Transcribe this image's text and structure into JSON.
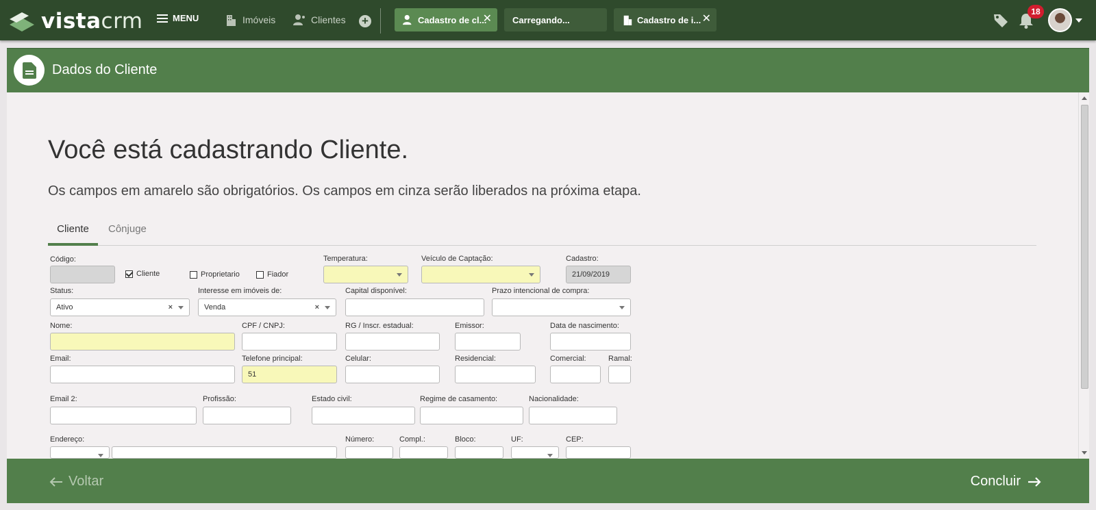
{
  "topbar": {
    "logo_bold": "vista",
    "logo_light": "crm",
    "menu_label": "MENU",
    "nav": [
      {
        "label": "Imóveis",
        "icon": "building-icon"
      },
      {
        "label": "Clientes",
        "icon": "client-icon"
      }
    ],
    "tabs": [
      {
        "label": "Cadastro de cl...",
        "icon": "client-icon",
        "active": true
      },
      {
        "label": "Carregando...",
        "icon": "",
        "active": false
      },
      {
        "label": "Cadastro de i...",
        "icon": "building-icon",
        "active": false
      }
    ],
    "notifications_count": "18",
    "colors": {
      "bar": "#2f4a2c",
      "accent": "#527f4b",
      "badge": "#d11d2e"
    }
  },
  "header": {
    "title": "Dados do Cliente",
    "icon": "document-icon"
  },
  "page": {
    "title": "Você está cadastrando Cliente.",
    "subtitle": "Os campos em amarelo são obrigatórios. Os campos em cinza serão liberados na próxima etapa.",
    "tabs": [
      "Cliente",
      "Cônjuge"
    ]
  },
  "form": {
    "codigo": {
      "label": "Código:",
      "value": ""
    },
    "check_cliente": {
      "label": "Cliente",
      "checked": true
    },
    "check_proprietario": {
      "label": "Proprietario",
      "checked": false
    },
    "check_fiador": {
      "label": "Fiador",
      "checked": false
    },
    "temperatura": {
      "label": "Temperatura:",
      "value": ""
    },
    "veiculo": {
      "label": "Veículo de Captação:",
      "value": ""
    },
    "cadastro": {
      "label": "Cadastro:",
      "value": "21/09/2019"
    },
    "status": {
      "label": "Status:",
      "value": "Ativo",
      "clear": "×"
    },
    "interesse": {
      "label": "Interesse em imóveis de:",
      "value": "Venda",
      "clear": "×"
    },
    "capital": {
      "label": "Capital disponível:",
      "value": ""
    },
    "prazo": {
      "label": "Prazo intencional de compra:",
      "value": ""
    },
    "nome": {
      "label": "Nome:",
      "value": ""
    },
    "cpf": {
      "label": "CPF / CNPJ:",
      "value": ""
    },
    "rg": {
      "label": "RG / Inscr. estadual:",
      "value": ""
    },
    "emissor": {
      "label": "Emissor:",
      "value": ""
    },
    "nascimento": {
      "label": "Data de nascimento:",
      "value": ""
    },
    "email": {
      "label": "Email:",
      "value": ""
    },
    "telefone": {
      "label": "Telefone principal:",
      "value": "51"
    },
    "celular": {
      "label": "Celular:",
      "value": ""
    },
    "residencial": {
      "label": "Residencial:",
      "value": ""
    },
    "comercial": {
      "label": "Comercial:",
      "value": ""
    },
    "ramal": {
      "label": "Ramal:",
      "value": ""
    },
    "email2": {
      "label": "Email 2:",
      "value": ""
    },
    "profissao": {
      "label": "Profissão:",
      "value": ""
    },
    "estado_civil": {
      "label": "Estado civil:",
      "value": ""
    },
    "regime": {
      "label": "Regime de casamento:",
      "value": ""
    },
    "nacionalidade": {
      "label": "Nacionalidade:",
      "value": ""
    },
    "endereco": {
      "label": "Endereço:",
      "value": ""
    },
    "numero": {
      "label": "Número:",
      "value": ""
    },
    "compl": {
      "label": "Compl.:",
      "value": ""
    },
    "bloco": {
      "label": "Bloco:",
      "value": ""
    },
    "uf": {
      "label": "UF:",
      "value": ""
    },
    "cep": {
      "label": "CEP:",
      "value": ""
    }
  },
  "footer": {
    "back_label": "Voltar",
    "next_label": "Concluir"
  }
}
